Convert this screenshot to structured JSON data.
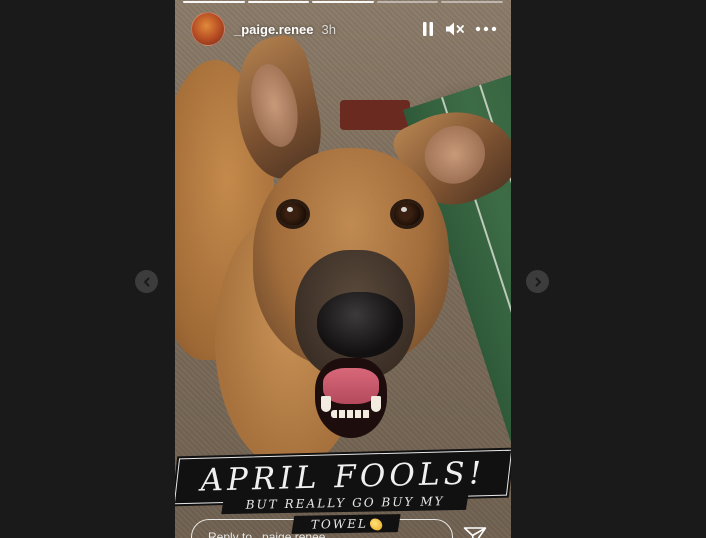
{
  "story": {
    "username": "_paige.renee",
    "time_ago": "3h",
    "progress_segments": 5,
    "progress_completed": 3,
    "reply_placeholder": "Reply to _paige.renee..."
  },
  "sticker": {
    "line1": "APRIL FOOLS!",
    "line2": "BUT REALLY GO BUY MY",
    "line3": "TOWEL"
  },
  "icons": {
    "pause": "pause-icon",
    "mute": "mute-icon",
    "more": "more-icon",
    "send": "send-icon",
    "prev": "chevron-left-icon",
    "next": "chevron-right-icon"
  },
  "colors": {
    "background": "#1a1a1a",
    "nav_button": "#3c3c3c",
    "text": "#ffffff"
  }
}
